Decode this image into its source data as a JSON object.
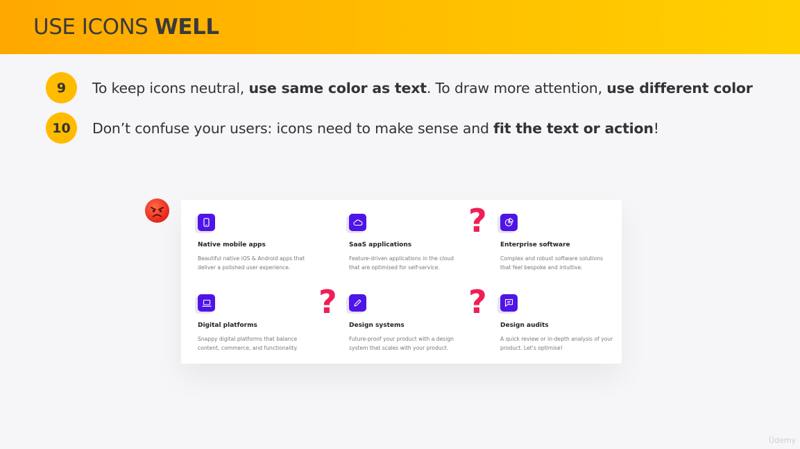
{
  "header": {
    "title_light": "USE ICONS ",
    "title_bold": "WELL"
  },
  "rules": [
    {
      "number": "9",
      "p1": "To keep icons neutral, ",
      "b1": "use same color as text",
      "p2": ". To draw more attention, ",
      "b2": "use different color"
    },
    {
      "number": "10",
      "p1": "Don’t confuse your users: icons need to make sense and ",
      "b1": "fit the text or action",
      "p2": "!"
    }
  ],
  "example": {
    "reaction_icon": "angry-face-icon",
    "question_mark": "?",
    "accent_color": "#4f14e6",
    "services": [
      {
        "icon": "smartphone-icon",
        "name": "Native mobile apps",
        "desc1": "Beautiful native iOS & Android apps that",
        "desc2": "deliver a polished user experience."
      },
      {
        "icon": "cloud-icon",
        "name": "SaaS applications",
        "desc1": "Feature-driven applications in the cloud",
        "desc2": "that are optimised for self-service."
      },
      {
        "icon": "pie-chart-icon",
        "name": "Enterprise software",
        "desc1": "Complex and robust software solutions",
        "desc2": "that feel bespoke and intuitive."
      },
      {
        "icon": "laptop-icon",
        "name": "Digital platforms",
        "desc1": "Snappy digital platforms that balance",
        "desc2": "content, commerce, and functionality."
      },
      {
        "icon": "pencil-icon",
        "name": "Design systems",
        "desc1": "Future-proof your product with a design",
        "desc2": "system that scales with your product."
      },
      {
        "icon": "message-square-icon",
        "name": "Design audits",
        "desc1": "A quick review or in-depth analysis of your",
        "desc2": "product. Let's optimise!"
      }
    ]
  },
  "watermark": "Ūdemy"
}
